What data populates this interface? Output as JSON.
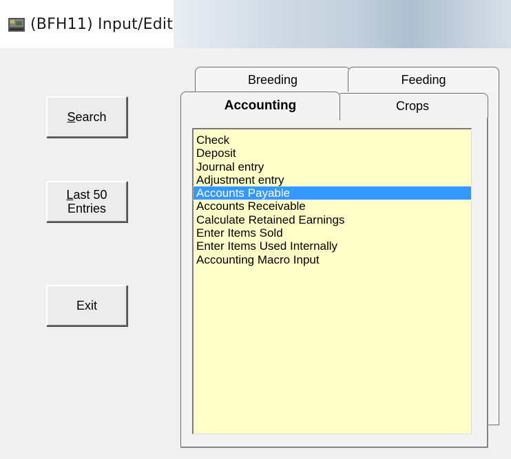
{
  "window": {
    "title": "(BFH11)  Input/Edit"
  },
  "buttons": {
    "search": {
      "mnemonic": "S",
      "rest": "earch"
    },
    "last50": {
      "mnemonic": "L",
      "rest_line1": "ast 50",
      "line2": "Entries"
    },
    "exit": {
      "label": "Exit"
    }
  },
  "tabs": {
    "back_row": [
      "Breeding",
      "Feeding"
    ],
    "front_row": [
      "Accounting",
      "Crops"
    ],
    "active": "Accounting"
  },
  "list": {
    "items": [
      "Check",
      "Deposit",
      "Journal entry",
      "Adjustment entry",
      "Accounts Payable",
      "Accounts Receivable",
      "Calculate Retained Earnings",
      "Enter Items Sold",
      "Enter Items Used Internally",
      "Accounting Macro Input"
    ],
    "selected": "Accounts Payable"
  },
  "colors": {
    "list_background": "#ffffc8",
    "selection": "#3399ff",
    "window_background": "#f0f0f0"
  }
}
